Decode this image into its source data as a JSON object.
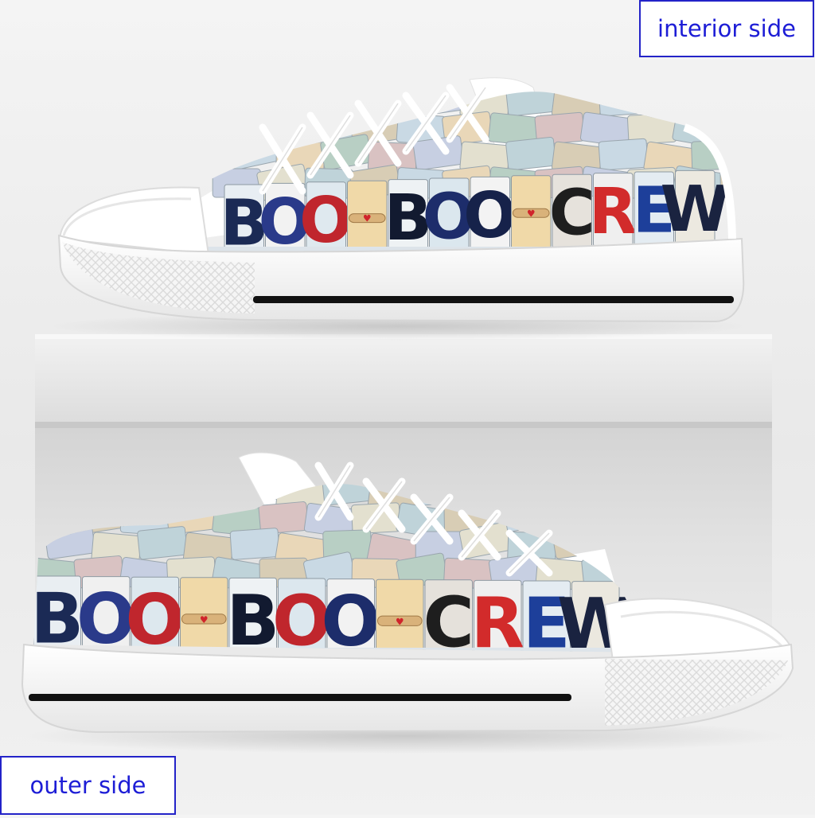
{
  "labels": {
    "interior": "interior side",
    "outer": "outer side"
  },
  "shoe_top": {
    "plates": [
      {
        "letter": "B",
        "bg": "#e8eef3",
        "color": "#1b2a55"
      },
      {
        "letter": "O",
        "bg": "#f2f2f2",
        "color": "#2a3a8a"
      },
      {
        "letter": "O",
        "bg": "#dfe9ef",
        "color": "#c0262d"
      },
      {
        "letter": "-",
        "bg": "#f0d9a8",
        "color": "#a8865a"
      },
      {
        "letter": "B",
        "bg": "#eef2f4",
        "color": "#121a30"
      },
      {
        "letter": "O",
        "bg": "#dbe7ee",
        "color": "#1d2d6b"
      },
      {
        "letter": "O",
        "bg": "#f3f3f3",
        "color": "#16224a"
      },
      {
        "letter": "-",
        "bg": "#f0d9a8",
        "color": "#a8865a"
      },
      {
        "letter": "C",
        "bg": "#e6e2dc",
        "color": "#1e1e1e"
      },
      {
        "letter": "R",
        "bg": "#efefef",
        "color": "#d22b2b"
      },
      {
        "letter": "E",
        "bg": "#e4ecf2",
        "color": "#1d3f9a"
      },
      {
        "letter": "W",
        "bg": "#ece9e0",
        "color": "#1a2340"
      }
    ]
  },
  "shoe_bottom": {
    "plates": [
      {
        "letter": "B",
        "bg": "#e9eef2",
        "color": "#1b2a55"
      },
      {
        "letter": "O",
        "bg": "#f0f0f0",
        "color": "#2a3a8a"
      },
      {
        "letter": "O",
        "bg": "#dde8ee",
        "color": "#c0262d"
      },
      {
        "letter": "-",
        "bg": "#f0d9a8",
        "color": "#a8865a"
      },
      {
        "letter": "B",
        "bg": "#eef2f4",
        "color": "#121a30"
      },
      {
        "letter": "O",
        "bg": "#dce7ee",
        "color": "#c0262d"
      },
      {
        "letter": "O",
        "bg": "#f2f2f2",
        "color": "#1d2d6b"
      },
      {
        "letter": "-",
        "bg": "#f0d9a8",
        "color": "#a8865a"
      },
      {
        "letter": "C",
        "bg": "#e5e1db",
        "color": "#1e1e1e"
      },
      {
        "letter": "R",
        "bg": "#efefef",
        "color": "#d22b2b"
      },
      {
        "letter": "E",
        "bg": "#e4ecf2",
        "color": "#1d3f9a"
      },
      {
        "letter": "W",
        "bg": "#ebe8df",
        "color": "#1a2340"
      }
    ]
  },
  "colors": {
    "label_border": "#2323c8",
    "label_text": "#1d1dd6",
    "sole": "#ffffff",
    "sole_stripe": "#111111",
    "box": "#e4e4e4"
  }
}
